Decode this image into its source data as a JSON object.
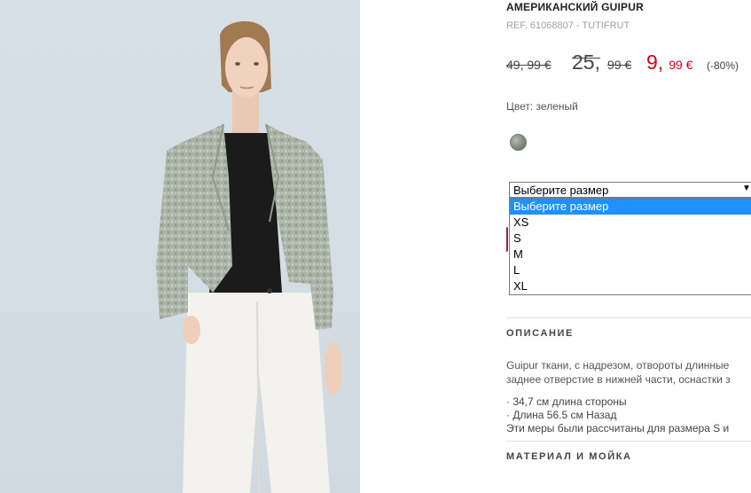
{
  "product": {
    "title": "АМЕРИКАНСКИЙ GUIPUR",
    "ref": "REF. 61068807 - TUTIFRUT"
  },
  "prices": {
    "original": "49, 99 €",
    "previous_main": "25,",
    "previous_cents": "99 €",
    "current_main": "9,",
    "current_cents": "99 €",
    "discount": "(-80%)",
    "sale_color": "#d0021b"
  },
  "color": {
    "label": "Цвет: зеленый",
    "swatch_name": "зеленый"
  },
  "size": {
    "selected": "Выберите размер",
    "options": [
      "Выберите размер",
      "XS",
      "S",
      "M",
      "L",
      "XL"
    ],
    "highlight_color": "#1e90ff"
  },
  "sections": {
    "description_title": "ОПИСАНИЕ",
    "description_text": "Guipur ткани, с надрезом, отвороты длинные",
    "description_text2": "заднее отверстие в нижней части, оснастки з",
    "measure1": "· 34,7 см длина стороны",
    "measure2": "· Длина 56.5 см Назад",
    "measure3": "Эти меры были рассчитаны для размера S и",
    "material_title": "МАТЕРИАЛ И МОЙКА"
  },
  "photo": {
    "subject": "model wearing lace jacket"
  }
}
